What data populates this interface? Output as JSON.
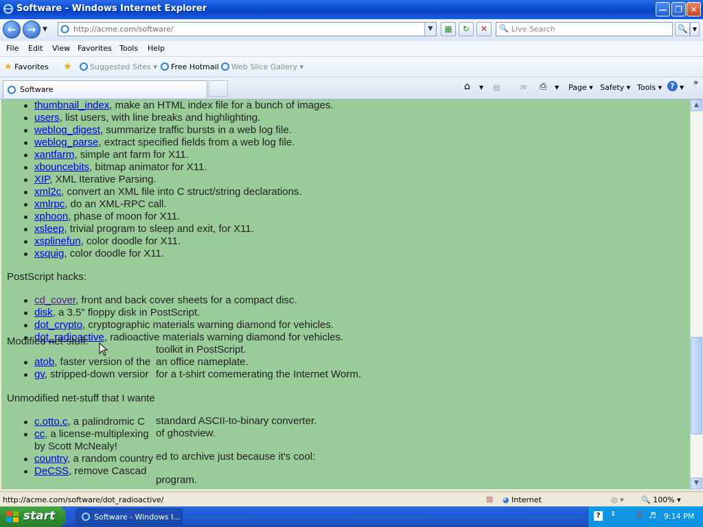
{
  "window": {
    "title": "Software - Windows Internet Explorer",
    "minimize": "0",
    "maximize": "1",
    "close": "r"
  },
  "navbar": {
    "back": "←",
    "forward": "→",
    "url": "http://acme.com/software/",
    "search_placeholder": "Live Search"
  },
  "menu": [
    "File",
    "Edit",
    "View",
    "Favorites",
    "Tools",
    "Help"
  ],
  "favorites_bar": {
    "favorites": "Favorites",
    "suggested": "Suggested Sites",
    "hotmail": "Free Hotmail",
    "webslice": "Web Slice Gallery"
  },
  "tab": {
    "label": "Software"
  },
  "commands": {
    "page": "Page",
    "safety": "Safety",
    "tools": "Tools"
  },
  "content": {
    "list1": [
      {
        "link": "thumbnail_index",
        "text": ", make an HTML index file for a bunch of images."
      },
      {
        "link": "users",
        "text": ", list users, with line breaks and highlighting."
      },
      {
        "link": "weblog_digest",
        "text": ", summarize traffic bursts in a web log file."
      },
      {
        "link": "weblog_parse",
        "text": ", extract specified fields from a web log file."
      },
      {
        "link": "xantfarm",
        "text": ", simple ant farm for X11."
      },
      {
        "link": "xbouncebits",
        "text": ", bitmap animator for X11."
      },
      {
        "link": "XIP",
        "text": ", XML Iterative Parsing."
      },
      {
        "link": "xml2c",
        "text": ", convert an XML file into C struct/string declarations."
      },
      {
        "link": "xmlrpc",
        "text": ", do an XML-RPC call."
      },
      {
        "link": "xphoon",
        "text": ", phase of moon for X11."
      },
      {
        "link": "xsleep",
        "text": ", trivial program to sleep and exit, for X11."
      },
      {
        "link": "xsplinefun",
        "text": ", color doodle for X11."
      },
      {
        "link": "xsquig",
        "text": ", color doodle for X11."
      }
    ],
    "heading_postscript": "PostScript hacks:",
    "list2": [
      {
        "link": "cd_cover",
        "text": ", front and back cover sheets for a compact disc."
      },
      {
        "link": "disk",
        "text": ", a 3.5\" floppy disk in PostScript."
      },
      {
        "link": "dot_crypto",
        "text": ", cryptographic materials warning diamond for vehicles."
      },
      {
        "link": "dot_radioactive",
        "text": ", radioactive materials warning diamond for vehicles."
      }
    ],
    "ghost_heading": "Modified net-stuff:",
    "list3": [
      {
        "link": "atob",
        "text": ", faster version of the"
      },
      {
        "link": "gv",
        "text": ", stripped-down versior"
      }
    ],
    "ghost_text": {
      "nameplate": "an office nameplate.",
      "toolkit": "toolkit in PostScript.",
      "tshirt": "for a t-shirt comemerating the Internet Worm.",
      "ascii": "standard ASCII-to-binary converter.",
      "ghostview": "of ghostview.",
      "archive": "ed to archive just because it's cool:",
      "program": "program."
    },
    "heading_unmodified": "Unmodified net-stuff that I wante",
    "list4": [
      {
        "link": "c.otto.c",
        "text": ", a palindromic C"
      },
      {
        "link": "cc",
        "text": ", a license-multiplexing"
      },
      {
        "link": "",
        "text": "by Scott McNealy!"
      },
      {
        "link": "country",
        "text": ", a random country"
      },
      {
        "link": "DeCSS",
        "text": ", remove Cascad"
      }
    ]
  },
  "statusbar": {
    "url": "http://acme.com/software/dot_radioactive/",
    "zone": "Internet",
    "zoom": "100%"
  },
  "taskbar": {
    "start": "start",
    "task": "Software - Windows I...",
    "clock": "9:14 PM"
  }
}
